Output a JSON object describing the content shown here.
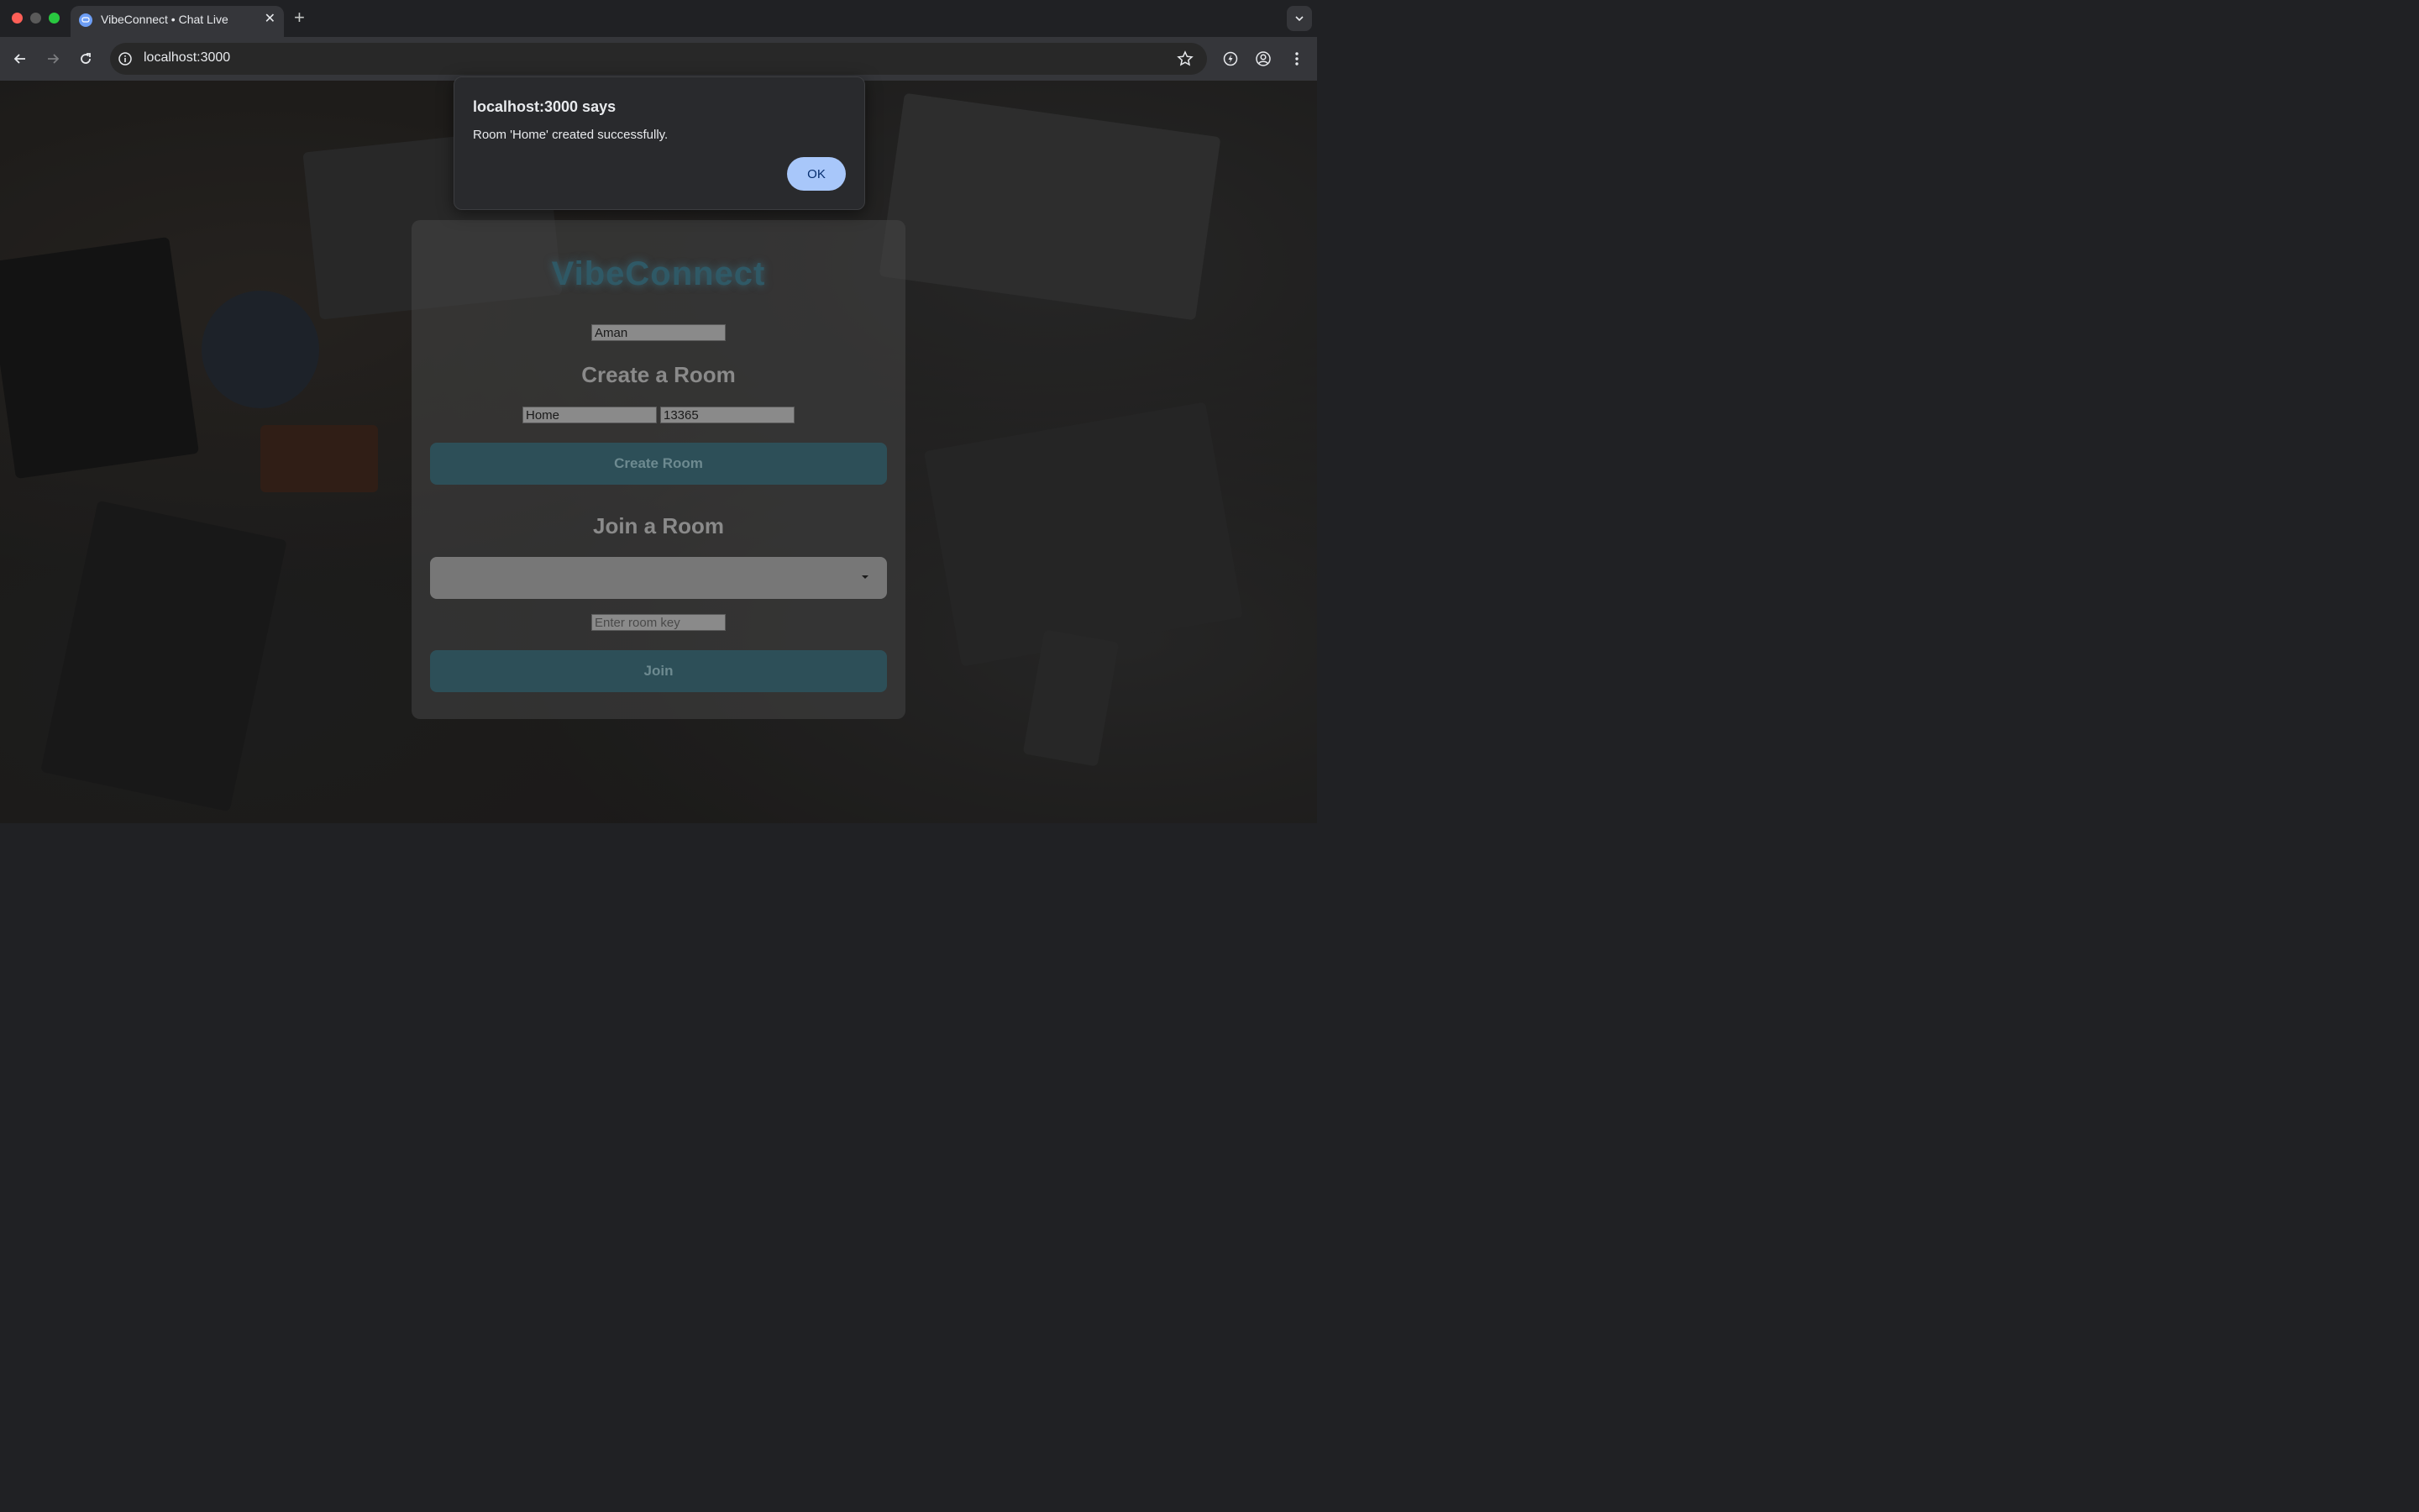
{
  "browser": {
    "tab_title": "VibeConnect • Chat Live",
    "tab_close": "✕",
    "new_tab": "+",
    "url": "localhost:3000"
  },
  "app": {
    "brand": "VibeConnect",
    "username_value": "Aman",
    "create_room": {
      "heading": "Create a Room",
      "room_name_value": "Home",
      "room_key_value": "13365",
      "button_label": "Create Room"
    },
    "join_room": {
      "heading": "Join a Room",
      "selected_room": "",
      "room_key_placeholder": "Enter room key",
      "button_label": "Join"
    }
  },
  "dialog": {
    "title": "localhost:3000 says",
    "message": "Room 'Home' created successfully.",
    "ok_label": "OK"
  }
}
